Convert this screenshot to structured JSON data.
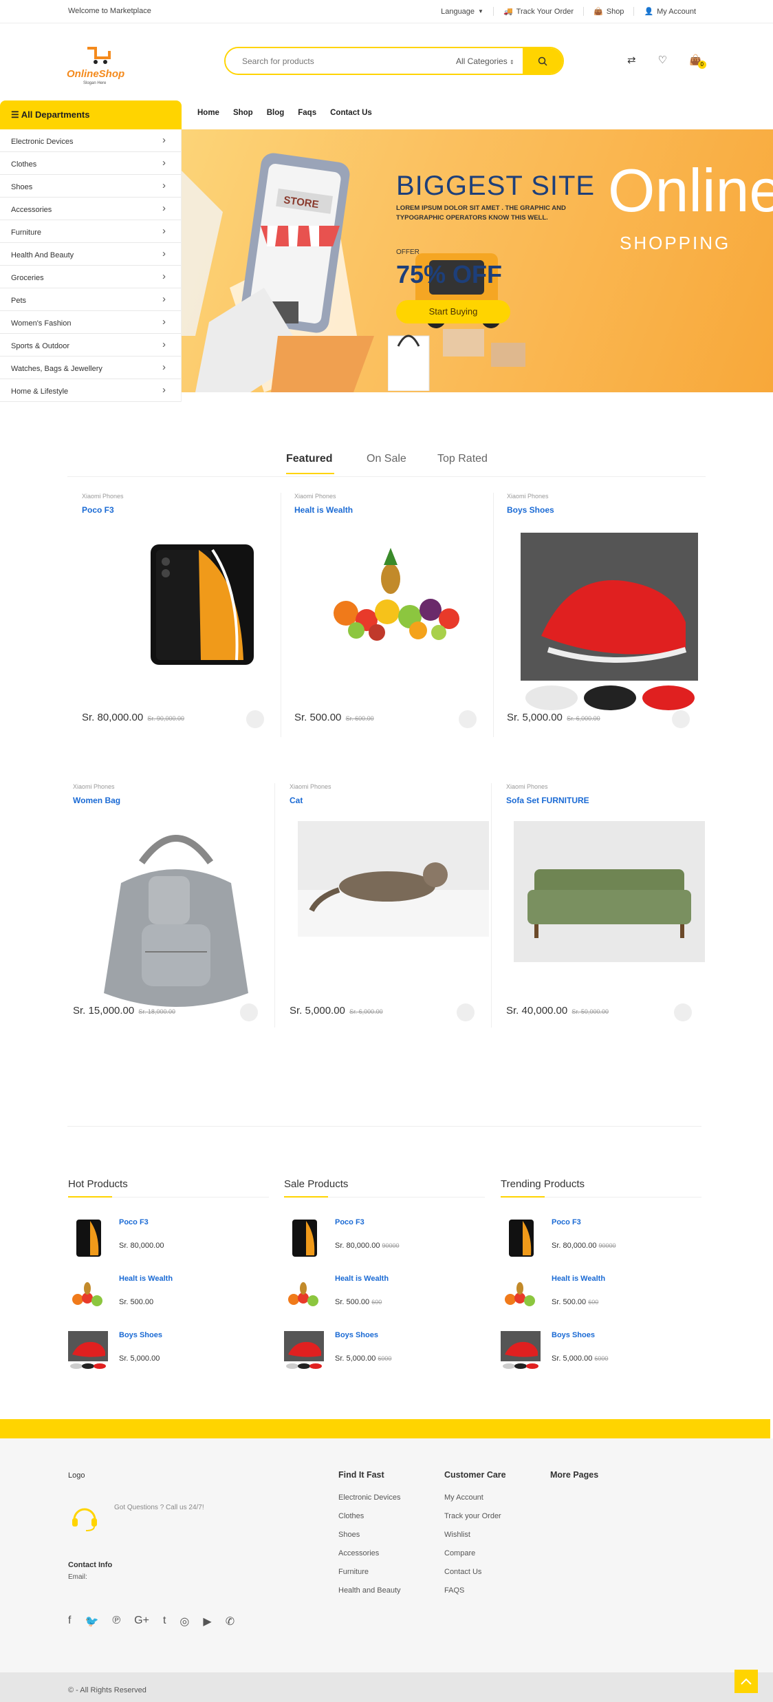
{
  "topbar": {
    "welcome": "Welcome to Marketplace",
    "language": "Language",
    "track": "Track Your Order",
    "shop": "Shop",
    "account": "My Account"
  },
  "header": {
    "logo_text": "OnlineShop",
    "logo_slogan": "Slogan Here",
    "search_placeholder": "Search for products",
    "category": "All Categories",
    "cart_count": "0"
  },
  "depts": {
    "title": "All Departments",
    "items": [
      "Electronic Devices",
      "Clothes",
      "Shoes",
      "Accessories",
      "Furniture",
      "Health And Beauty",
      "Groceries",
      "Pets",
      "Women's Fashion",
      "Sports & Outdoor",
      "Watches, Bags & Jewellery",
      "Home & Lifestyle"
    ]
  },
  "nav": [
    "Home",
    "Shop",
    "Blog",
    "Faqs",
    "Contact Us"
  ],
  "hero": {
    "title": "BIGGEST SITE",
    "subtitle": "LOREM IPSUM DOLOR SIT AMET . THE GRAPHIC AND TYPOGRAPHIC OPERATORS KNOW THIS WELL.",
    "offer_label": "OFFER",
    "offer": "75% OFF",
    "button": "Start Buying",
    "online": "Online",
    "shopping": "SHOPPING",
    "store_sign": "STORE"
  },
  "tabs": [
    "Featured",
    "On Sale",
    "Top Rated"
  ],
  "products": [
    {
      "brand": "Xiaomi Phones",
      "name": "Poco F3",
      "price": "Sr. 80,000.00",
      "old": "Sr. 90,000.00"
    },
    {
      "brand": "Xiaomi Phones",
      "name": "Healt is Wealth",
      "price": "Sr. 500.00",
      "old": "Sr. 600.00"
    },
    {
      "brand": "Xiaomi Phones",
      "name": "Boys Shoes",
      "price": "Sr. 5,000.00",
      "old": "Sr. 6,000.00"
    },
    {
      "brand": "Xiaomi Phones",
      "name": "Women Bag",
      "price": "Sr. 15,000.00",
      "old": "Sr. 18,000.00"
    },
    {
      "brand": "Xiaomi Phones",
      "name": "Cat",
      "price": "Sr. 5,000.00",
      "old": "Sr. 6,000.00"
    },
    {
      "brand": "Xiaomi Phones",
      "name": "Sofa Set FURNITURE",
      "price": "Sr. 40,000.00",
      "old": "Sr. 50,000.00"
    }
  ],
  "columns": [
    {
      "title": "Hot Products",
      "items": [
        {
          "name": "Poco F3",
          "price": "Sr. 80,000.00",
          "old": ""
        },
        {
          "name": "Healt is Wealth",
          "price": "Sr. 500.00",
          "old": ""
        },
        {
          "name": "Boys Shoes",
          "price": "Sr. 5,000.00",
          "old": ""
        }
      ]
    },
    {
      "title": "Sale Products",
      "items": [
        {
          "name": "Poco F3",
          "price": "Sr. 80,000.00",
          "old": "90000"
        },
        {
          "name": "Healt is Wealth",
          "price": "Sr. 500.00",
          "old": "600"
        },
        {
          "name": "Boys Shoes",
          "price": "Sr. 5,000.00",
          "old": "6000"
        }
      ]
    },
    {
      "title": "Trending Products",
      "items": [
        {
          "name": "Poco F3",
          "price": "Sr. 80,000.00",
          "old": "90000"
        },
        {
          "name": "Healt is Wealth",
          "price": "Sr. 500.00",
          "old": "600"
        },
        {
          "name": "Boys Shoes",
          "price": "Sr. 5,000.00",
          "old": "6000"
        }
      ]
    }
  ],
  "footer": {
    "logo": "Logo",
    "question": "Got Questions ? Call us 24/7!",
    "contact_title": "Contact Info",
    "email": "Email:",
    "find_title": "Find It Fast",
    "find": [
      "Electronic Devices",
      "Clothes",
      "Shoes",
      "Accessories",
      "Furniture",
      "Health and Beauty"
    ],
    "care_title": "Customer Care",
    "care": [
      "My Account",
      "Track your Order",
      "Wishlist",
      "Compare",
      "Contact Us",
      "FAQS"
    ],
    "more_title": "More Pages",
    "copyright": "© - All Rights Reserved"
  },
  "colors": {
    "accent": "#ffd400",
    "link": "#1a6ad4",
    "hero_title": "#1d3f7a"
  }
}
